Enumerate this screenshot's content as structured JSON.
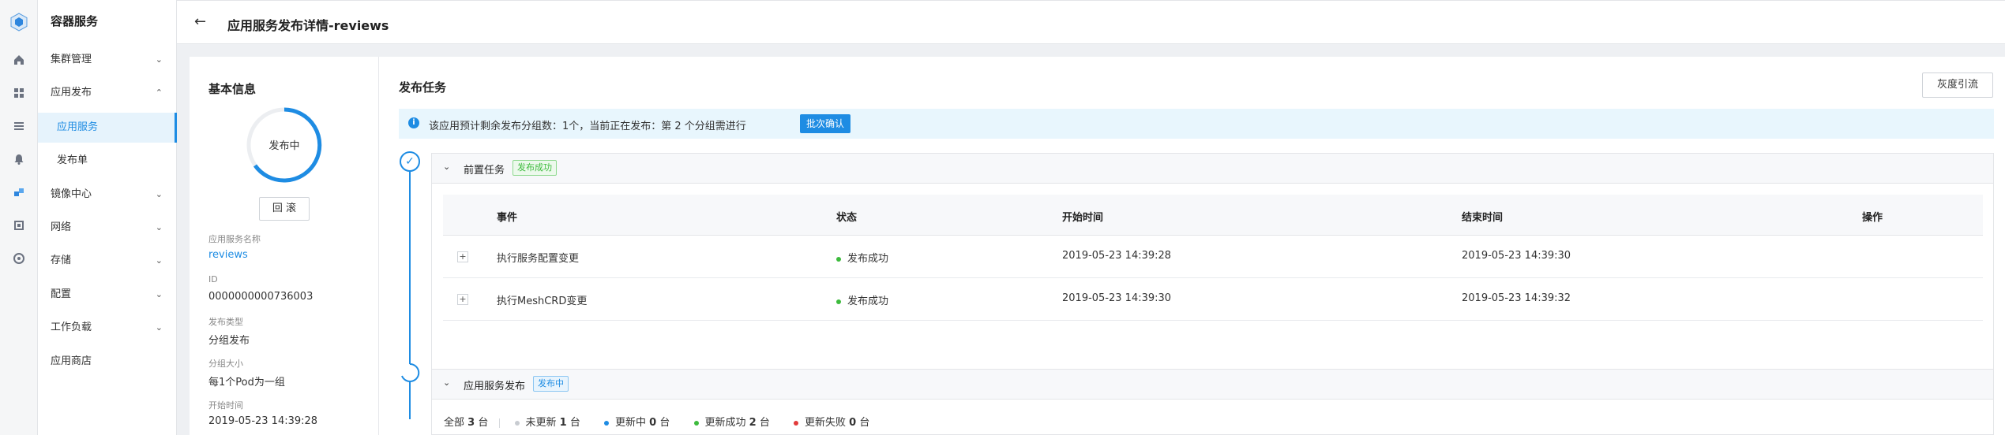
{
  "app": {
    "title": "容器服务"
  },
  "sidebar": {
    "items": [
      {
        "label": "集群管理",
        "chevron": "down"
      },
      {
        "label": "应用发布",
        "chevron": "up"
      },
      {
        "label": "应用服务",
        "active": true
      },
      {
        "label": "发布单"
      },
      {
        "label": "镜像中心",
        "chevron": "down"
      },
      {
        "label": "网络",
        "chevron": "down"
      },
      {
        "label": "存储",
        "chevron": "down"
      },
      {
        "label": "配置",
        "chevron": "down"
      },
      {
        "label": "工作负载",
        "chevron": "down"
      },
      {
        "label": "应用商店"
      }
    ]
  },
  "header": {
    "title": "应用服务发布详情-reviews"
  },
  "basic": {
    "title": "基本信息",
    "status": "发布中",
    "rollback": "回 滚",
    "fields": [
      {
        "label": "应用服务名称",
        "value": "reviews",
        "link": true
      },
      {
        "label": "ID",
        "value": "0000000000736003"
      },
      {
        "label": "发布类型",
        "value": "分组发布"
      },
      {
        "label": "分组大小",
        "value": "每1个Pod为一组"
      },
      {
        "label": "开始时间",
        "value": "2019-05-23 14:39:28"
      }
    ]
  },
  "task": {
    "title": "发布任务",
    "gray_button": "灰度引流",
    "notice": "该应用预计剩余发布分组数：1个，当前正在发布：第 2 个分组需进行",
    "confirm_button": "批次确认",
    "pre": {
      "title": "前置任务",
      "tag": "发布成功",
      "columns": [
        "事件",
        "状态",
        "开始时间",
        "结束时间",
        "操作"
      ],
      "rows": [
        {
          "event": "执行服务配置变更",
          "status": "发布成功",
          "start": "2019-05-23 14:39:28",
          "end": "2019-05-23 14:39:30"
        },
        {
          "event": "执行MeshCRD变更",
          "status": "发布成功",
          "start": "2019-05-23 14:39:30",
          "end": "2019-05-23 14:39:32"
        }
      ]
    },
    "release": {
      "title": "应用服务发布",
      "tag": "发布中",
      "total_label": "全部",
      "total": "3",
      "unit": "台",
      "stats": [
        {
          "label": "未更新",
          "count": "1",
          "color": "#c8ccd1"
        },
        {
          "label": "更新中",
          "count": "0",
          "color": "#1e8ce3"
        },
        {
          "label": "更新成功",
          "count": "2",
          "color": "#3dbb3d"
        },
        {
          "label": "更新失败",
          "count": "0",
          "color": "#e23b3b"
        }
      ]
    }
  },
  "colors": {
    "accent": "#1e8ce3",
    "success": "#3dbb3d",
    "danger": "#e23b3b"
  }
}
